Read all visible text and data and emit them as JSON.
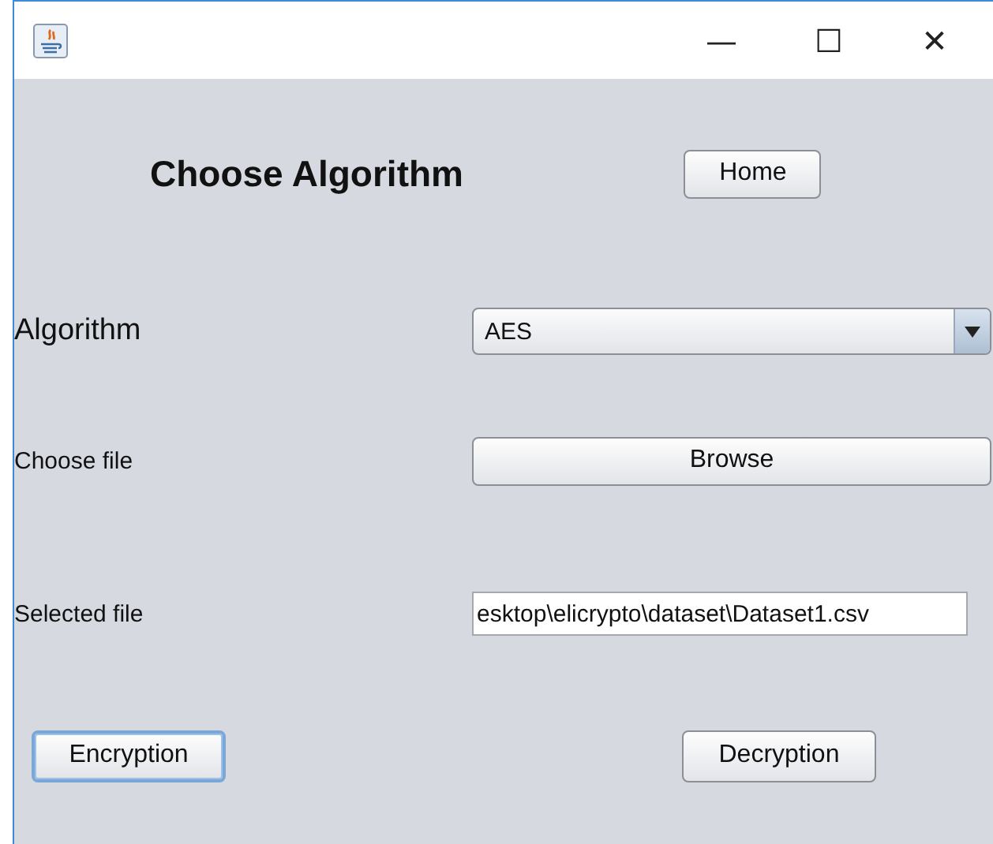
{
  "window": {
    "title_bar_buttons": [
      "—",
      "☐",
      "✕"
    ]
  },
  "heading": "Choose Algorithm",
  "home_button": {
    "label": "Home",
    "focused": false
  },
  "algorithm": {
    "label": "Algorithm",
    "value": "AES"
  },
  "choose_file": {
    "label": "Choose file",
    "button": "Browse"
  },
  "selected_file": {
    "label": "Selected file",
    "value": "esktop\\elicrypto\\dataset\\Dataset1.csv"
  },
  "actions": [
    {
      "label": "Encryption",
      "focused": true
    },
    {
      "label": "Decryption",
      "focused": false
    }
  ]
}
